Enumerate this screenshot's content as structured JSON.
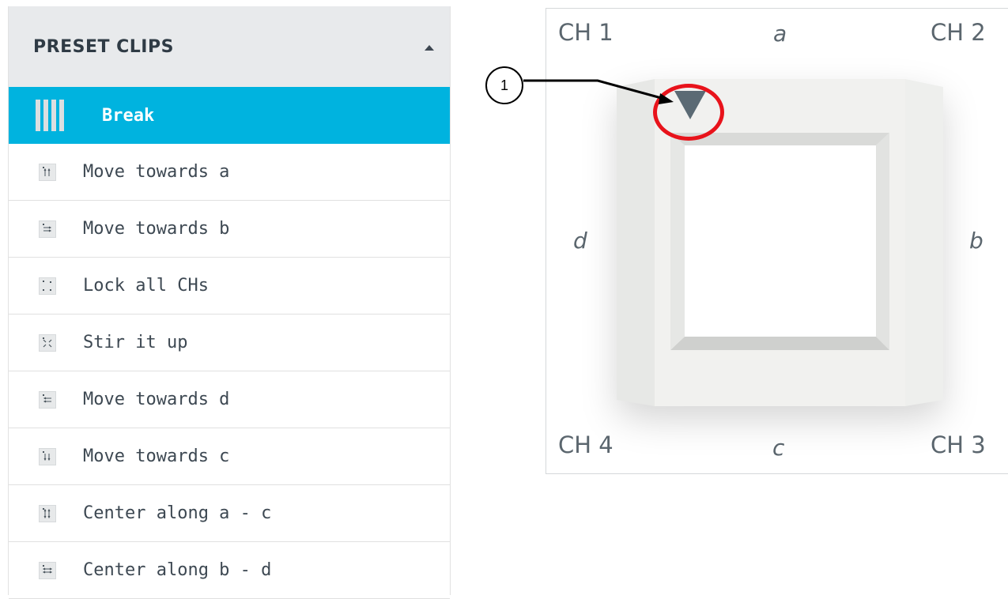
{
  "panel": {
    "title": "PRESET CLIPS",
    "items": [
      {
        "label": "Break",
        "icon": "break-icon",
        "active": true
      },
      {
        "label": "Move towards a",
        "icon": "move-up-icon"
      },
      {
        "label": "Move towards b",
        "icon": "move-right-icon"
      },
      {
        "label": "Lock all CHs",
        "icon": "lock-all-icon"
      },
      {
        "label": "Stir it up",
        "icon": "stir-icon"
      },
      {
        "label": "Move towards d",
        "icon": "move-left-icon"
      },
      {
        "label": "Move towards c",
        "icon": "move-down-icon"
      },
      {
        "label": "Center along a - c",
        "icon": "center-vertical-icon"
      },
      {
        "label": "Center along b - d",
        "icon": "center-horizontal-icon"
      }
    ]
  },
  "figure": {
    "ch1": "CH 1",
    "ch2": "CH 2",
    "ch3": "CH 3",
    "ch4": "CH 4",
    "dir_a": "a",
    "dir_b": "b",
    "dir_c": "c",
    "dir_d": "d"
  },
  "callout": {
    "number": "1"
  },
  "colors": {
    "accent": "#00b3df",
    "highlight": "#e8131b",
    "handle": "#5b6a74"
  }
}
